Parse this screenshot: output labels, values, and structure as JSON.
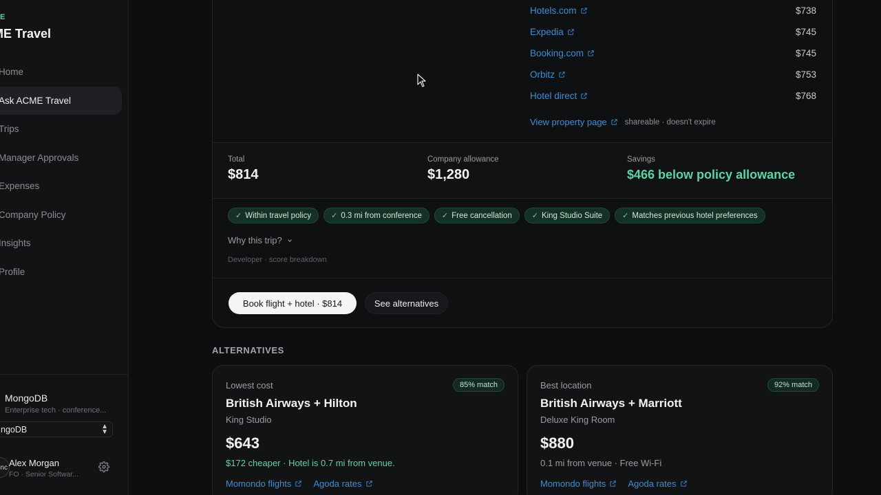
{
  "sidebar": {
    "brand_tag": "E",
    "brand_title": "ME Travel",
    "nav": [
      {
        "label": "Home",
        "active": false
      },
      {
        "label": "Ask ACME Travel",
        "active": true
      },
      {
        "label": "Trips",
        "active": false
      },
      {
        "label": "Manager Approvals",
        "active": false
      },
      {
        "label": "Expenses",
        "active": false
      },
      {
        "label": "Company Policy",
        "active": false
      },
      {
        "label": "Insights",
        "active": false
      },
      {
        "label": "Profile",
        "active": false
      }
    ],
    "org": {
      "name": "MongoDB",
      "subtitle": "Enterprise tech · conference...",
      "select_value": "ngoDB"
    },
    "user": {
      "avatar_text": "enc",
      "name": "Alex Morgan",
      "role": "FO · Senior Softwar..."
    }
  },
  "rates": [
    {
      "provider": "Hotels.com",
      "price": "$738"
    },
    {
      "provider": "Expedia",
      "price": "$745"
    },
    {
      "provider": "Booking.com",
      "price": "$745"
    },
    {
      "provider": "Orbitz",
      "price": "$753"
    },
    {
      "provider": "Hotel direct",
      "price": "$768"
    }
  ],
  "view_property": {
    "label": "View property page",
    "note": "shareable · doesn't expire"
  },
  "summary": {
    "total_label": "Total",
    "total_value": "$814",
    "allowance_label": "Company allowance",
    "allowance_value": "$1,280",
    "savings_label": "Savings",
    "savings_value": "$466 below policy allowance"
  },
  "chips": [
    "Within travel policy",
    "0.3 mi from conference",
    "Free cancellation",
    "King Studio Suite",
    "Matches previous hotel preferences"
  ],
  "why_label": "Why this trip?",
  "developer_note": "Developer · score breakdown",
  "actions": {
    "book_label": "Book flight + hotel · $814",
    "alternatives_label": "See alternatives"
  },
  "alternatives": {
    "heading": "ALTERNATIVES",
    "items": [
      {
        "category": "Lowest cost",
        "match": "85% match",
        "title": "British Airways + Hilton",
        "room": "King Studio",
        "price": "$643",
        "desc": "$172 cheaper · Hotel is 0.7 mi from venue.",
        "desc_highlight": true,
        "links": [
          "Momondo flights",
          "Agoda rates"
        ]
      },
      {
        "category": "Best location",
        "match": "92% match",
        "title": "British Airways + Marriott",
        "room": "Deluxe King Room",
        "price": "$880",
        "desc": "0.1 mi from venue · Free Wi-Fi",
        "desc_highlight": false,
        "links": [
          "Momondo flights",
          "Agoda rates"
        ]
      }
    ]
  },
  "colors": {
    "accent_green": "#5fd3a4",
    "link_blue": "#3b8fd9",
    "background": "#0d0e10"
  }
}
